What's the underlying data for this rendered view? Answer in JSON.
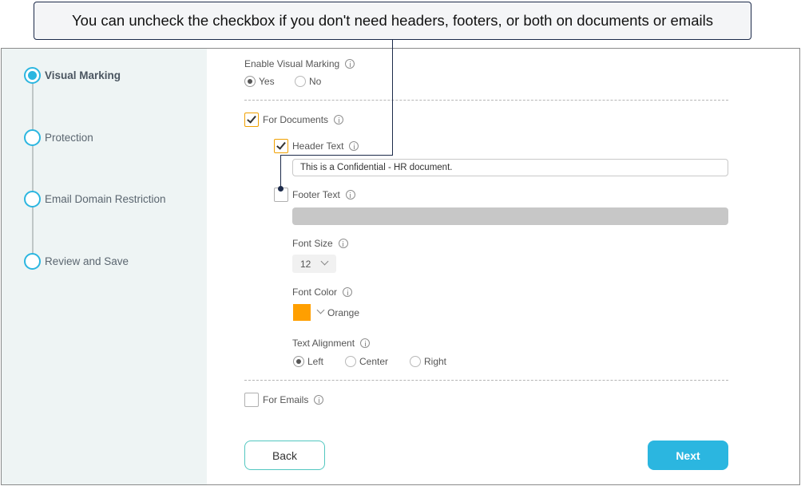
{
  "callout": {
    "text": "You can uncheck the checkbox if you don't need headers, footers, or both on documents or emails"
  },
  "steps": [
    {
      "label": "Visual Marking",
      "active": true
    },
    {
      "label": "Protection",
      "active": false
    },
    {
      "label": "Email Domain Restriction",
      "active": false
    },
    {
      "label": "Review and Save",
      "active": false
    }
  ],
  "visual_marking": {
    "label": "Enable Visual Marking",
    "options": [
      {
        "label": "Yes",
        "checked": true
      },
      {
        "label": "No",
        "checked": false
      }
    ]
  },
  "for_documents": {
    "label": "For Documents",
    "checked": true
  },
  "header_text": {
    "label": "Header Text",
    "checked": true,
    "value": "This is a Confidential - HR document."
  },
  "footer_text": {
    "label": "Footer Text",
    "checked": false,
    "value": ""
  },
  "font_size": {
    "label": "Font Size",
    "value": "12"
  },
  "font_color": {
    "label": "Font Color",
    "value": "Orange",
    "swatch": "#ff9f00"
  },
  "text_alignment": {
    "label": "Text Alignment",
    "options": [
      {
        "label": "Left",
        "checked": true
      },
      {
        "label": "Center",
        "checked": false
      },
      {
        "label": "Right",
        "checked": false
      }
    ]
  },
  "for_emails": {
    "label": "For Emails",
    "checked": false
  },
  "buttons": {
    "back": "Back",
    "next": "Next"
  },
  "colors": {
    "accent": "#2bb6e0",
    "checkbox_border": "#f0a000",
    "back_border": "#52c7c0",
    "sidebar_bg": "#eef4f4",
    "callout_border": "#1c2a4a"
  }
}
